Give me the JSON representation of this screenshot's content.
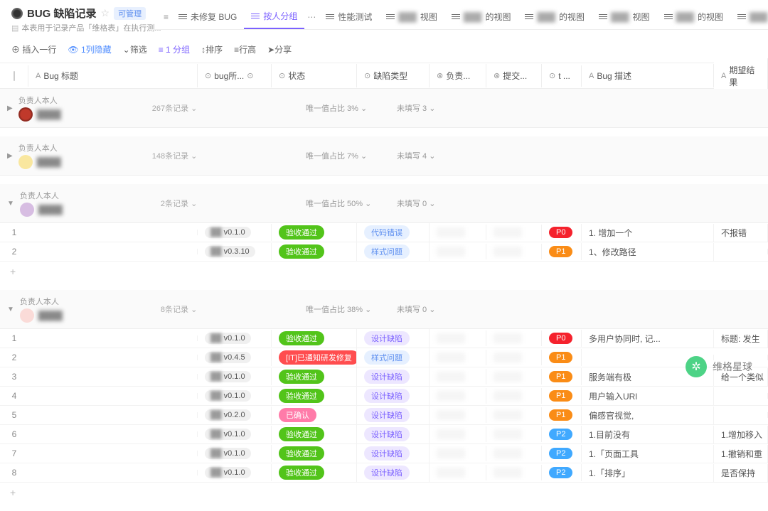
{
  "header": {
    "title": "BUG 缺陷记录",
    "manage_tag": "可管理",
    "subtitle": "本表用于记录产品「维格表」在执行测..."
  },
  "tabs": [
    {
      "label": "未修复 BUG",
      "active": false
    },
    {
      "label": "按人分组",
      "active": true
    },
    {
      "label": "性能测试",
      "active": false
    },
    {
      "label": "视图",
      "blur": true
    },
    {
      "label": "的视图",
      "blur": true
    },
    {
      "label": "的视图",
      "blur": true
    },
    {
      "label": "视图",
      "blur": true
    },
    {
      "label": "的视图",
      "blur": true
    },
    {
      "label": "",
      "blur": true
    },
    {
      "label": "",
      "blur": true
    }
  ],
  "toolbar": {
    "insert_row": "插入一行",
    "hide_col": "1列隐藏",
    "filter": "筛选",
    "group": "1 分组",
    "sort": "排序",
    "row_height": "行高",
    "share": "分享"
  },
  "columns": {
    "title": "Bug 标题",
    "belong": "bug所...",
    "status": "状态",
    "defect_type": "缺陷类型",
    "owner": "负责...",
    "commit": "提交...",
    "priority": "t ...",
    "desc": "Bug 描述",
    "expect": "期望结果"
  },
  "groups": [
    {
      "label": "负责人本人",
      "avatar": "red",
      "name": "████",
      "count": "267条记录",
      "collapsed": true,
      "unique": "唯一值占比 3%",
      "unfilled": "未填写 3",
      "rows": []
    },
    {
      "label": "负责人本人",
      "avatar": "yellow",
      "name": "████",
      "count": "148条记录",
      "collapsed": true,
      "unique": "唯一值占比 7%",
      "unfilled": "未填写 4",
      "rows": []
    },
    {
      "label": "负责人本人",
      "avatar": "purple",
      "name": "████",
      "count": "2条记录",
      "collapsed": false,
      "unique": "唯一值占比 50%",
      "unfilled": "未填写 0",
      "rows": [
        {
          "n": "1",
          "ver": "v0.1.0",
          "status": "验收通过",
          "status_c": "green",
          "type": "代码错误",
          "type_c": "blue-lt",
          "pri": "P0",
          "pri_c": "p0",
          "desc": "1. 增加一个",
          "expect": "不报错"
        },
        {
          "n": "2",
          "ver": "v0.3.10",
          "status": "验收通过",
          "status_c": "green",
          "type": "样式问题",
          "type_c": "blue-lt",
          "pri": "P1",
          "pri_c": "p1",
          "desc": "1、修改路径",
          "expect": ""
        }
      ]
    },
    {
      "label": "负责人本人",
      "avatar": "pink",
      "name": "████",
      "count": "8条记录",
      "collapsed": false,
      "unique": "唯一值占比 38%",
      "unfilled": "未填写 0",
      "rows": [
        {
          "n": "1",
          "ver": "v0.1.0",
          "status": "验收通过",
          "status_c": "green",
          "type": "设计缺陷",
          "type_c": "purple-lt",
          "pri": "P0",
          "pri_c": "p0",
          "desc": "多用户协同时,           记...",
          "expect": "标题: 发生"
        },
        {
          "n": "2",
          "ver": "v0.4.5",
          "status": "[IT]已通知研发修复",
          "status_c": "red",
          "type": "样式问题",
          "type_c": "blue-lt",
          "pri": "P1",
          "pri_c": "p1",
          "desc": "",
          "expect": ""
        },
        {
          "n": "3",
          "ver": "v0.1.0",
          "status": "验收通过",
          "status_c": "green",
          "type": "设计缺陷",
          "type_c": "purple-lt",
          "pri": "P1",
          "pri_c": "p1",
          "desc": "服务端有极",
          "expect": "给一个类似"
        },
        {
          "n": "4",
          "ver": "v0.1.0",
          "status": "验收通过",
          "status_c": "green",
          "type": "设计缺陷",
          "type_c": "purple-lt",
          "pri": "P1",
          "pri_c": "p1",
          "desc": "用户输入URl",
          "expect": ""
        },
        {
          "n": "5",
          "ver": "v0.2.0",
          "status": "已确认",
          "status_c": "pink",
          "type": "设计缺陷",
          "type_c": "purple-lt",
          "pri": "P1",
          "pri_c": "p1",
          "desc": "偏感官视觉,",
          "expect": ""
        },
        {
          "n": "6",
          "ver": "v0.1.0",
          "status": "验收通过",
          "status_c": "green",
          "type": "设计缺陷",
          "type_c": "purple-lt",
          "pri": "P2",
          "pri_c": "p2",
          "desc": "1.目前没有",
          "expect": "1.增加移入"
        },
        {
          "n": "7",
          "ver": "v0.1.0",
          "status": "验收通过",
          "status_c": "green",
          "type": "设计缺陷",
          "type_c": "purple-lt",
          "pri": "P2",
          "pri_c": "p2",
          "desc": "1.「页面工具",
          "expect": "1.撤销和重"
        },
        {
          "n": "8",
          "ver": "v0.1.0",
          "status": "验收通过",
          "status_c": "green",
          "type": "设计缺陷",
          "type_c": "purple-lt",
          "pri": "P2",
          "pri_c": "p2",
          "desc": "1.「排序」",
          "expect": "是否保持"
        }
      ]
    }
  ],
  "watermark": "维格星球"
}
